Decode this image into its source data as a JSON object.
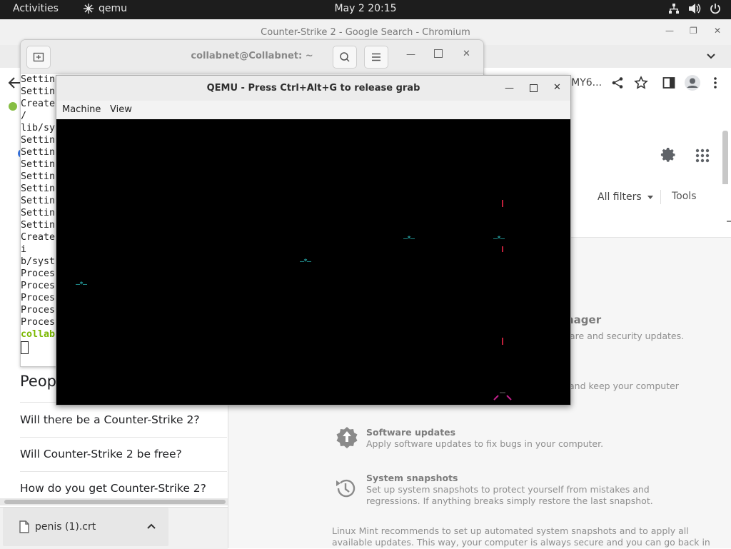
{
  "topbar": {
    "activities": "Activities",
    "app_name": "qemu",
    "clock": "May 2  20:15",
    "tray_icons": [
      "network-icon",
      "volume-icon",
      "power-icon"
    ]
  },
  "chromium": {
    "window_title": "Counter-Strike 2 - Google Search - Chromium",
    "url_partial": "IMY6...",
    "search_tools": {
      "all_filters": "All filters",
      "tools": "Tools"
    },
    "people_also_ask": {
      "heading": "Peop",
      "questions": [
        "Will there be a Counter-Strike 2?",
        "Will Counter-Strike 2 be free?",
        "How do you get Counter-Strike 2?"
      ]
    },
    "download": {
      "filename": "penis (1).crt"
    }
  },
  "welcome_panel": {
    "update_manager_title": "nager",
    "update_manager_desc": "are and security updates.",
    "keep_desc": "and keep your computer",
    "software_updates_title": "Software updates",
    "software_updates_desc": "Apply software updates to fix bugs in your computer.",
    "snapshots_title": "System snapshots",
    "snapshots_desc_1": "Set up system snapshots to protect yourself from mistakes and",
    "snapshots_desc_2": "regressions. If anything breaks simply restore the last snapshot.",
    "recommend_1": "Linux Mint recommends to set up automated system snapshots and to apply all",
    "recommend_2": "available updates. This way, your computer is always secure and you can go back in"
  },
  "terminal": {
    "title": "collabnet@Collabnet: ~",
    "lines": [
      "Settin",
      "Settin",
      "Create",
      "/",
      "lib/sy",
      "Settin",
      "Settin",
      "Settin",
      "Settin",
      "Settin",
      "Settin",
      "Settin",
      "Settin",
      "Create",
      "i",
      "b/syst",
      "Proces",
      "Proces",
      "Proces",
      "Proces",
      "Proces"
    ],
    "prompt": "collab"
  },
  "qemu": {
    "title": "QEMU - Press Ctrl+Alt+G to release grab",
    "menu": [
      "Machine",
      "View"
    ],
    "entity_glyph": "—*—"
  },
  "colors": {
    "topbar_bg": "#1d1d1d",
    "terminal_prompt": "#7ab800",
    "qemu_entity": "#2ec9c9",
    "qemu_red": "#c0203a",
    "qemu_magenta": "#c0208a"
  }
}
